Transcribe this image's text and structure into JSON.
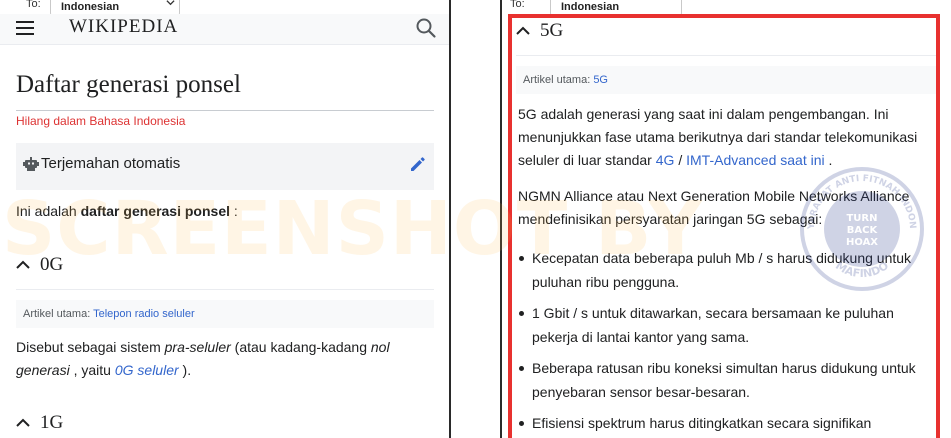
{
  "left": {
    "lang": {
      "to_label": "To:",
      "language": "Indonesian"
    },
    "header": {
      "wordmark": "WIKIPEDIA"
    },
    "title": "Daftar generasi ponsel",
    "missing_language": "Hilang dalam Bahasa Indonesia",
    "translate": {
      "label": "Terjemahan otomatis"
    },
    "intro": {
      "prefix": "Ini adalah ",
      "bold": "daftar generasi ponsel",
      "suffix": " :"
    },
    "section_0g": {
      "heading": "0G",
      "hatnote_prefix": "Artikel utama: ",
      "hatnote_link": "Telepon radio seluler",
      "p1_a": "Disebut sebagai sistem ",
      "p1_i1": "pra-seluler",
      "p1_b": " (atau kadang-kadang ",
      "p1_i2": "nol",
      "p2_i": "generasi",
      "p2_a": " , yaitu ",
      "p2_link": "0G seluler",
      "p2_b": " )."
    },
    "section_1g": {
      "heading": "1G"
    }
  },
  "right": {
    "lang": {
      "to_label": "To:",
      "language": "Indonesian"
    },
    "section_5g": {
      "heading": "5G",
      "hatnote_prefix": "Artikel utama: ",
      "hatnote_link": "5G",
      "p1_l1": "5G adalah generasi yang saat ini dalam pengembangan. Ini",
      "p1_l2": "menunjukkan fase utama berikutnya dari standar telekomunikasi",
      "p1_l3_a": "seluler di luar standar ",
      "p1_l3_link1": "4G",
      "p1_l3_sep": " / ",
      "p1_l3_link2": "IMT-Advanced saat ini",
      "p1_l3_b": " .",
      "p2_l1": "NGMN Alliance atau Next Generation Mobile Networks Alliance",
      "p2_l2": "mendefinisikan persyaratan jaringan 5G sebagai:",
      "bullets": [
        {
          "l1": "Kecepatan data beberapa puluh Mb / s harus didukung untuk",
          "l2": "puluhan ribu pengguna."
        },
        {
          "l1": "1 Gbit / s untuk ditawarkan, secara bersamaan ke puluhan",
          "l2": "pekerja di lantai kantor yang sama."
        },
        {
          "l1": "Beberapa ratusan ribu koneksi simultan harus didukung untuk",
          "l2": "penyebaran sensor besar-besaran."
        },
        {
          "l1": "Efisiensi spektrum harus ditingkatkan secara signifikan",
          "l2": ""
        }
      ]
    }
  },
  "overlay": {
    "watermark": "SCREENSHOT BY",
    "stamp_top": "MASYARAKAT ANTI FITNAH INDONESIA",
    "stamp_mid1": "TURN",
    "stamp_mid2": "BACK",
    "stamp_mid3": "HOAX",
    "stamp_bottom": "MAFINDO"
  },
  "colors": {
    "link": "#3366cc",
    "missing": "#dd3333",
    "highlight": "#e8312f",
    "pencil": "#3366cc"
  }
}
